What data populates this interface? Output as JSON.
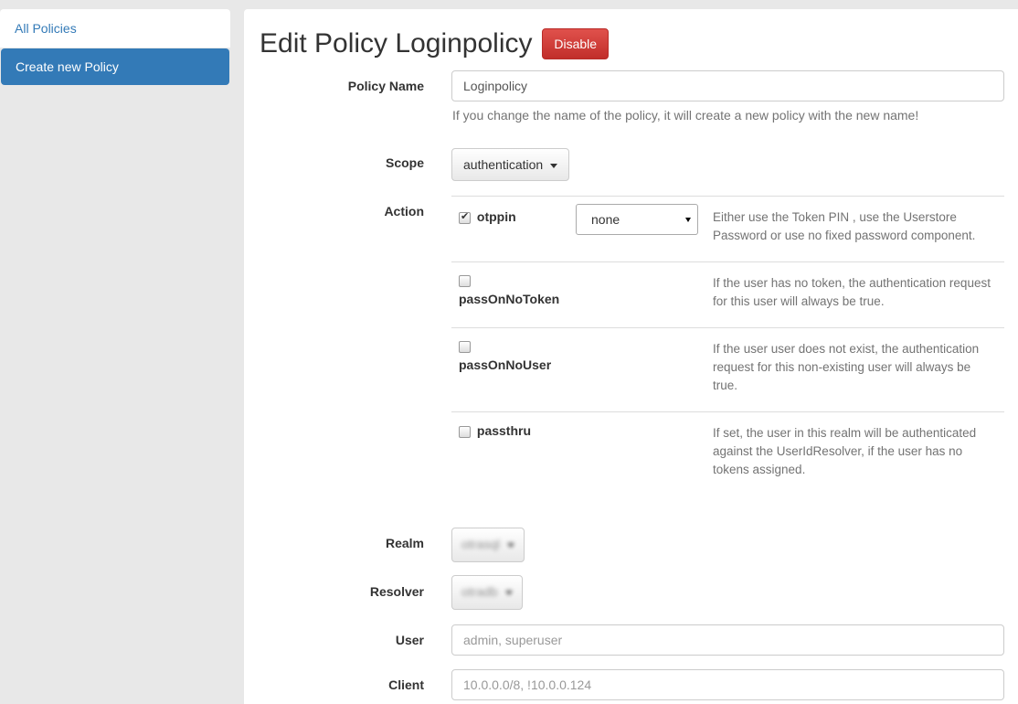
{
  "sidebar": {
    "items": [
      {
        "label": "All Policies"
      },
      {
        "label": "Create new Policy"
      }
    ]
  },
  "header": {
    "title": "Edit Policy Loginpolicy",
    "disable_label": "Disable"
  },
  "form": {
    "policy_name": {
      "label": "Policy Name",
      "value": "Loginpolicy",
      "help": "If you change the name of the policy, it will create a new policy with the new name!"
    },
    "scope": {
      "label": "Scope",
      "value": "authentication"
    },
    "action": {
      "label": "Action",
      "rows": [
        {
          "name": "otppin",
          "checked": true,
          "select_value": "none",
          "desc": "Either use the Token PIN , use the Userstore Password or use no fixed password component."
        },
        {
          "name": "passOnNoToken",
          "checked": false,
          "desc": "If the user has no token, the authentication request for this user will always be true."
        },
        {
          "name": "passOnNoUser",
          "checked": false,
          "desc": "If the user user does not exist, the authentication request for this non-existing user will always be true."
        },
        {
          "name": "passthru",
          "checked": false,
          "desc": "If set, the user in this realm will be authenticated against the UserIdResolver, if the user has no tokens assigned."
        }
      ]
    },
    "realm": {
      "label": "Realm",
      "value": "otrasql"
    },
    "resolver": {
      "label": "Resolver",
      "value": "otradb"
    },
    "user": {
      "label": "User",
      "placeholder": "admin, superuser"
    },
    "client": {
      "label": "Client",
      "placeholder": "10.0.0.0/8, !10.0.0.124"
    }
  },
  "colors": {
    "primary": "#337ab7",
    "danger": "#d9534f"
  }
}
